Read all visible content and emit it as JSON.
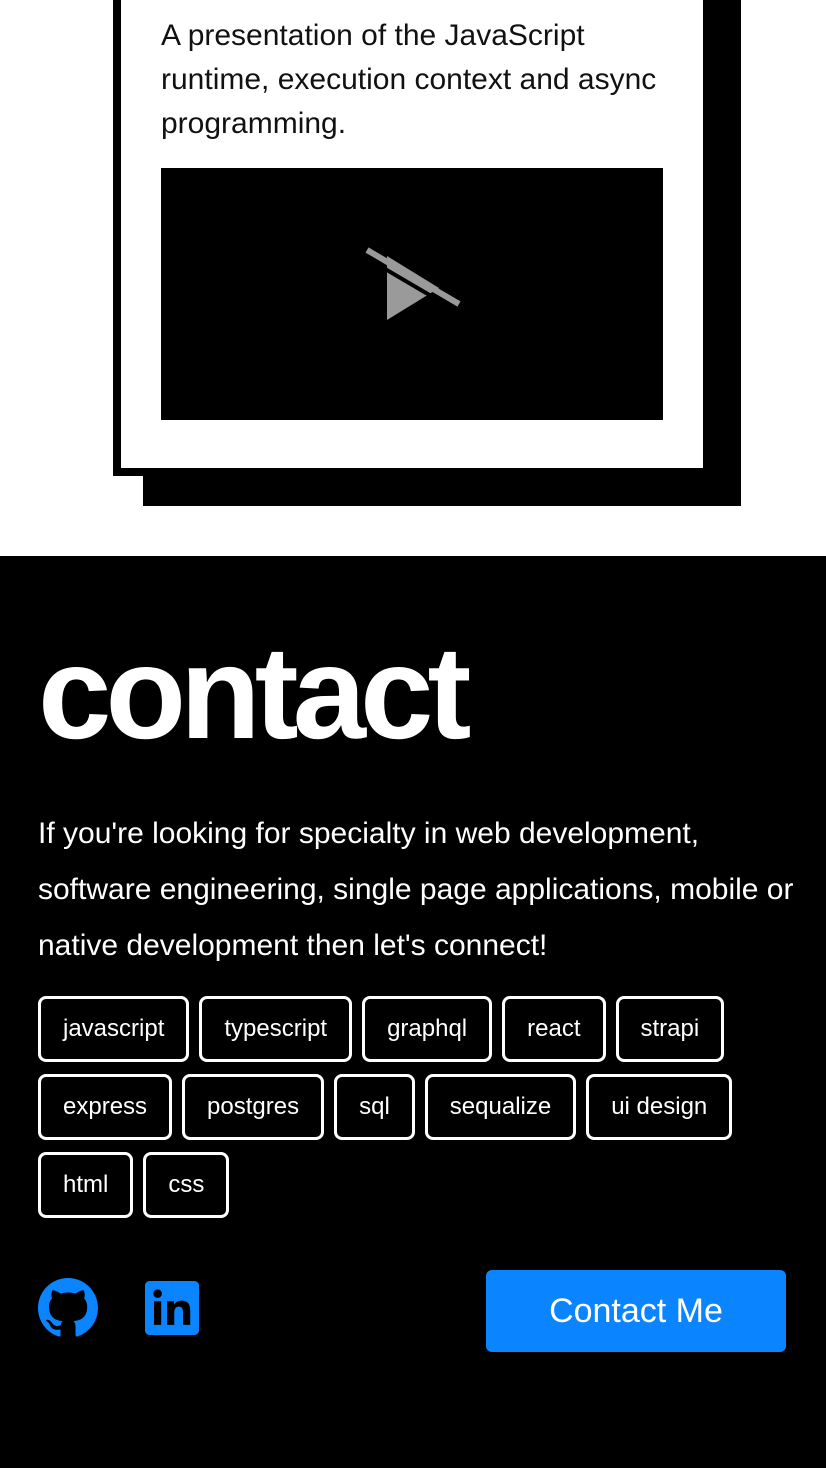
{
  "project": {
    "description": "A presentation of the JavaScript runtime, execution context and async programming."
  },
  "contact": {
    "title": "contact",
    "text": "If you're looking for specialty in web development, software engineering, single page applications, mobile or native development then let's connect!",
    "tags": [
      "javascript",
      "typescript",
      "graphql",
      "react",
      "strapi",
      "express",
      "postgres",
      "sql",
      "sequalize",
      "ui design",
      "html",
      "css"
    ],
    "button_label": "Contact Me",
    "socials": [
      {
        "icon": "github-icon"
      },
      {
        "icon": "linkedin-icon"
      }
    ]
  },
  "colors": {
    "accent": "#0a84ff",
    "background_dark": "#000000",
    "background_light": "#ffffff"
  }
}
